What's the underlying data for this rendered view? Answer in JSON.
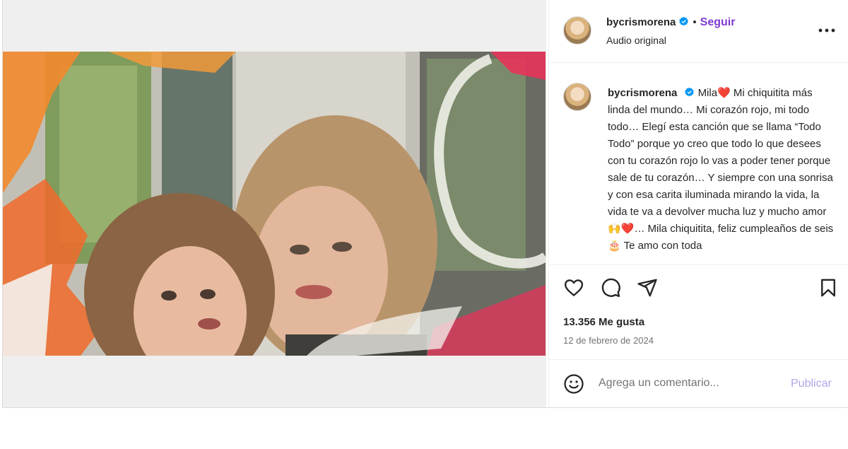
{
  "post": {
    "username": "bycrismorena",
    "follow_label": "Seguir",
    "separator": "•",
    "audio_label": "Audio original",
    "caption_text": "Mila❤️ Mi chiquitita más linda del mundo… Mi corazón rojo, mi todo todo… Elegí esta canción que se llama “Todo Todo” porque yo creo que todo lo que desees con tu corazón rojo lo vas a poder tener porque sale de tu corazón… Y siempre con una sonrisa y con esa carita iluminada mirando la vida, la vida te va a devolver mucha luz y mucho amor🙌❤️… Mila chiquitita, feliz cumpleaños de seis🎂 Te amo con toda",
    "likes": "13.356 Me gusta",
    "date": "12 de febrero de 2024",
    "comment_placeholder": "Agrega un comentario...",
    "publish_label": "Publicar"
  },
  "icons": {
    "verified": "verified-badge-icon",
    "more": "more-options-icon",
    "like": "heart-icon",
    "comment": "comment-icon",
    "share": "share-icon",
    "save": "bookmark-icon",
    "emoji": "emoji-icon",
    "mute": "mute-icon"
  },
  "colors": {
    "follow": "#7e3bd1",
    "verified": "#0095f6",
    "publish_disabled": "#b2a4e8",
    "secondary_text": "#737373"
  }
}
